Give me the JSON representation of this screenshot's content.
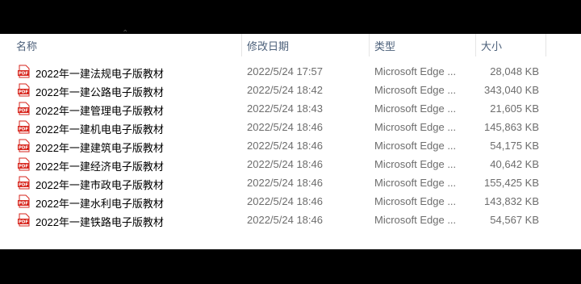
{
  "columns": {
    "name": "名称",
    "modified": "修改日期",
    "type": "类型",
    "size": "大小"
  },
  "icon": "pdf-file-icon",
  "accent_color": "#d7261d",
  "files": [
    {
      "name": "2022年一建法规电子版教材",
      "modified": "2022/5/24 17:57",
      "type": "Microsoft Edge ...",
      "size": "28,048 KB"
    },
    {
      "name": "2022年一建公路电子版教材",
      "modified": "2022/5/24 18:42",
      "type": "Microsoft Edge ...",
      "size": "343,040 KB"
    },
    {
      "name": "2022年一建管理电子版教材",
      "modified": "2022/5/24 18:43",
      "type": "Microsoft Edge ...",
      "size": "21,605 KB"
    },
    {
      "name": "2022年一建机电电子版教材",
      "modified": "2022/5/24 18:46",
      "type": "Microsoft Edge ...",
      "size": "145,863 KB"
    },
    {
      "name": "2022年一建建筑电子版教材",
      "modified": "2022/5/24 18:46",
      "type": "Microsoft Edge ...",
      "size": "54,175 KB"
    },
    {
      "name": "2022年一建经济电子版教材",
      "modified": "2022/5/24 18:46",
      "type": "Microsoft Edge ...",
      "size": "40,642 KB"
    },
    {
      "name": "2022年一建市政电子版教材",
      "modified": "2022/5/24 18:46",
      "type": "Microsoft Edge ...",
      "size": "155,425 KB"
    },
    {
      "name": "2022年一建水利电子版教材",
      "modified": "2022/5/24 18:46",
      "type": "Microsoft Edge ...",
      "size": "143,832 KB"
    },
    {
      "name": "2022年一建铁路电子版教材",
      "modified": "2022/5/24 18:46",
      "type": "Microsoft Edge ...",
      "size": "54,567 KB"
    }
  ]
}
